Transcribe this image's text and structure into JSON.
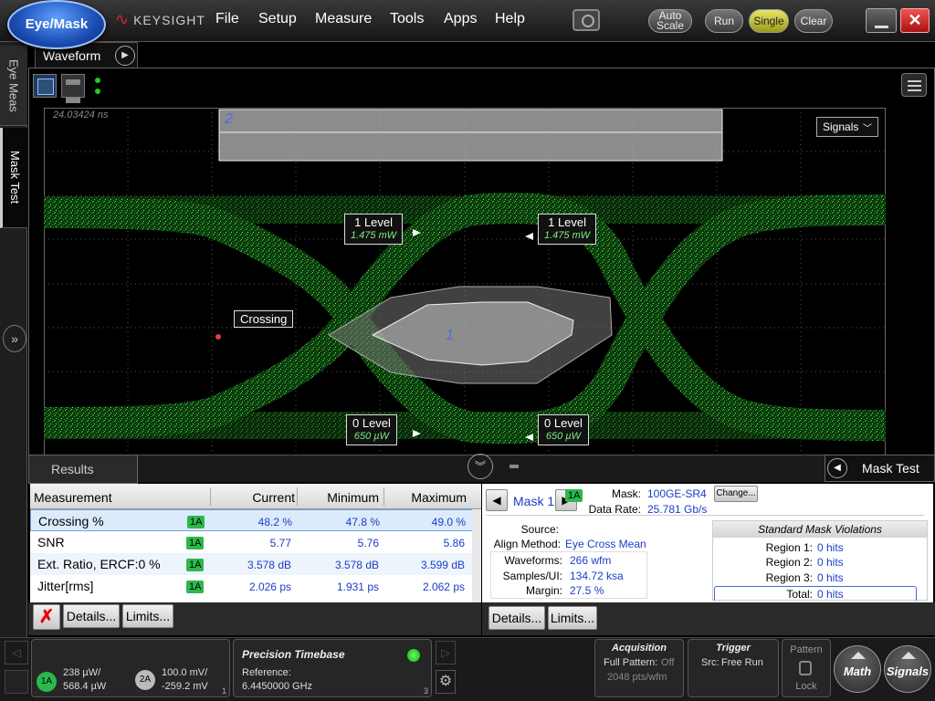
{
  "app": {
    "mode_button": "Eye/Mask",
    "brand": "KEYSIGHT"
  },
  "menu": [
    "File",
    "Setup",
    "Measure",
    "Tools",
    "Apps",
    "Help"
  ],
  "toolbar": {
    "auto_scale_line1": "Auto",
    "auto_scale_line2": "Scale",
    "run": "Run",
    "single": "Single",
    "clear": "Clear"
  },
  "left_tabs": {
    "eye_meas": "Eye Meas",
    "mask_test": "Mask Test"
  },
  "waveform": {
    "tab_label": "Waveform",
    "time_label": "24.03424 ns",
    "signals_dropdown": "Signals",
    "mask_region_1": "1",
    "mask_region_2": "2",
    "callouts": {
      "one_level_left": {
        "label": "1 Level",
        "value": "1.475 mW"
      },
      "one_level_right": {
        "label": "1 Level",
        "value": "1.475 mW"
      },
      "zero_level_left": {
        "label": "0 Level",
        "value": "650 µW"
      },
      "zero_level_right": {
        "label": "0 Level",
        "value": "650 µW"
      },
      "crossing": {
        "label": "Crossing"
      }
    }
  },
  "results": {
    "tab_label": "Results",
    "columns": [
      "Measurement",
      "Current",
      "Minimum",
      "Maximum"
    ],
    "rows": [
      {
        "name": "Crossing %",
        "source": "1A",
        "current": "48.2 %",
        "minimum": "47.8 %",
        "maximum": "49.0 %"
      },
      {
        "name": "SNR",
        "source": "1A",
        "current": "5.77",
        "minimum": "5.76",
        "maximum": "5.86"
      },
      {
        "name": "Ext. Ratio, ERCF:0 %",
        "source": "1A",
        "current": "3.578 dB",
        "minimum": "3.578 dB",
        "maximum": "3.599 dB"
      },
      {
        "name": "Jitter[rms]",
        "source": "1A",
        "current": "2.026 ps",
        "minimum": "1.931 ps",
        "maximum": "2.062 ps"
      }
    ],
    "details_button": "Details...",
    "limits_button": "Limits..."
  },
  "mask_test": {
    "tab_label": "Mask Test",
    "mask_selector": "Mask 1",
    "mask_label": "Mask:",
    "mask_name": "100GE-SR4",
    "change_button": "Change...",
    "data_rate_label": "Data Rate:",
    "data_rate": "25.781 Gb/s",
    "source_label": "Source:",
    "source": "1A",
    "align_label": "Align Method:",
    "align_method": "Eye Cross Mean",
    "waveforms_label": "Waveforms:",
    "waveforms": "266 wfm",
    "samples_label": "Samples/UI:",
    "samples": "134.72 ksa",
    "margin_label": "Margin:",
    "margin": "27.5 %",
    "violations_title": "Standard Mask Violations",
    "regions": [
      {
        "label": "Region 1:",
        "value": "0 hits"
      },
      {
        "label": "Region 2:",
        "value": "0 hits"
      },
      {
        "label": "Region 3:",
        "value": "0 hits"
      }
    ],
    "total_label": "Total:",
    "total": "0 hits",
    "details_button": "Details...",
    "limits_button": "Limits..."
  },
  "status": {
    "channel_1a_badge": "1A",
    "channel_1a_line1": "238 µW/",
    "channel_1a_line2": "568.4 µW",
    "channel_2a_badge": "2A",
    "channel_2a_line1": "100.0 mV/",
    "channel_2a_line2": "-259.2 mV",
    "channel_box_num": "1",
    "timebase_title": "Precision Timebase",
    "timebase_ref_label": "Reference:",
    "timebase_ref_value": "6.4450000 GHz",
    "timebase_box_num": "3",
    "acq_title": "Acquisition",
    "acq_line1_label": "Full Pattern:",
    "acq_line1_value": "Off",
    "acq_line2": "2048 pts/wfm",
    "trigger_title": "Trigger",
    "trigger_src_label": "Src:",
    "trigger_src_value": "Free Run",
    "pattern_label": "Pattern",
    "lock_label": "Lock",
    "math_button": "Math",
    "signals_button": "Signals"
  }
}
